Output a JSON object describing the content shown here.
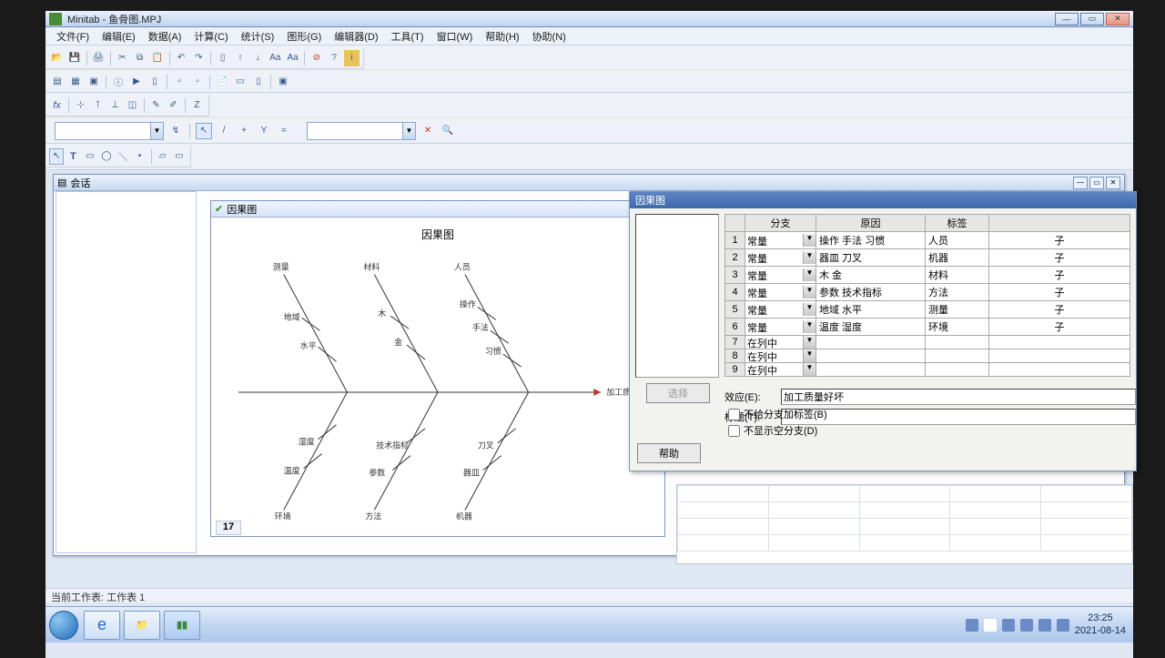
{
  "app": {
    "title": "Minitab - 鱼骨图.MPJ"
  },
  "menu": [
    "文件(F)",
    "编辑(E)",
    "数据(A)",
    "计算(C)",
    "统计(S)",
    "图形(G)",
    "编辑器(D)",
    "工具(T)",
    "窗口(W)",
    "帮助(H)",
    "协助(N)"
  ],
  "session": {
    "title": "会话"
  },
  "chartwin": {
    "title": "因果图"
  },
  "chart": {
    "title": "因果图",
    "effect_label": "加工质量好坏",
    "branches": {
      "topleft": "测量",
      "topmid": "材料",
      "topright": "人员",
      "botleft": "环境",
      "botmid": "方法",
      "botright": "机器"
    }
  },
  "rownum": "17",
  "dialog": {
    "title": "因果图",
    "headers": {
      "branch": "分支",
      "cause": "原因",
      "label": "标签",
      "sub": ""
    },
    "rows": [
      {
        "idx": "1",
        "type": "常量",
        "cause": "操作 手法 习惯",
        "label": "人员",
        "sub": "子"
      },
      {
        "idx": "2",
        "type": "常量",
        "cause": "器皿 刀叉",
        "label": "机器",
        "sub": "子"
      },
      {
        "idx": "3",
        "type": "常量",
        "cause": "木 金",
        "label": "材料",
        "sub": "子"
      },
      {
        "idx": "4",
        "type": "常量",
        "cause": "参数 技术指标",
        "label": "方法",
        "sub": "子"
      },
      {
        "idx": "5",
        "type": "常量",
        "cause": "地域 水平",
        "label": "测量",
        "sub": "子"
      },
      {
        "idx": "6",
        "type": "常量",
        "cause": "温度 湿度",
        "label": "环境",
        "sub": "子"
      },
      {
        "idx": "7",
        "type": "在列中",
        "cause": "",
        "label": "",
        "sub": ""
      },
      {
        "idx": "8",
        "type": "在列中",
        "cause": "",
        "label": "",
        "sub": ""
      },
      {
        "idx": "9",
        "type": "在列中",
        "cause": "",
        "label": "",
        "sub": ""
      }
    ],
    "effect_label": "效应(E):",
    "effect_value": "加工质量好坏",
    "title_label": "标题(T):",
    "title_value": "",
    "check1": "不给分支加标签(B)",
    "check2": "不显示空分支(D)",
    "select_btn": "选择",
    "help_btn": "帮助"
  },
  "statusbar": "当前工作表: 工作表 1",
  "clock": {
    "time": "23:25",
    "date": "2021-08-14"
  },
  "chart_data": {
    "type": "fishbone",
    "effect": "加工质量好坏",
    "branches": [
      {
        "side": "top",
        "name": "测量",
        "causes": [
          "地域",
          "水平"
        ]
      },
      {
        "side": "top",
        "name": "材料",
        "causes": [
          "木",
          "金"
        ]
      },
      {
        "side": "top",
        "name": "人员",
        "causes": [
          "操作",
          "手法",
          "习惯"
        ]
      },
      {
        "side": "bottom",
        "name": "环境",
        "causes": [
          "温度",
          "湿度"
        ]
      },
      {
        "side": "bottom",
        "name": "方法",
        "causes": [
          "参数",
          "技术指标"
        ]
      },
      {
        "side": "bottom",
        "name": "机器",
        "causes": [
          "器皿",
          "刀叉"
        ]
      }
    ]
  }
}
